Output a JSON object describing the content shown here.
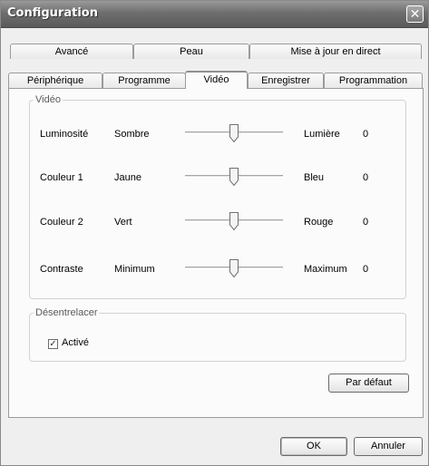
{
  "window": {
    "title": "Configuration",
    "close_symbol": "✕"
  },
  "tabs": {
    "row1": [
      {
        "label": "Avancé"
      },
      {
        "label": "Peau"
      },
      {
        "label": "Mise à jour en direct"
      }
    ],
    "row2": [
      {
        "label": "Périphérique"
      },
      {
        "label": "Programme"
      },
      {
        "label": "Vidéo",
        "active": true
      },
      {
        "label": "Enregistrer"
      },
      {
        "label": "Programmation"
      }
    ]
  },
  "video_group": {
    "title": "Vidéo",
    "rows": [
      {
        "label": "Luminosité",
        "min": "Sombre",
        "max": "Lumière",
        "value": "0",
        "position": 0.5
      },
      {
        "label": "Couleur 1",
        "min": "Jaune",
        "max": "Bleu",
        "value": "0",
        "position": 0.5
      },
      {
        "label": "Couleur 2",
        "min": "Vert",
        "max": "Rouge",
        "value": "0",
        "position": 0.5
      },
      {
        "label": "Contraste",
        "min": "Minimum",
        "max": "Maximum",
        "value": "0",
        "position": 0.5
      }
    ]
  },
  "deinterlace_group": {
    "title": "Désentrelacer",
    "checkbox_label": "Activé",
    "checked": true
  },
  "buttons": {
    "default_label": "Par défaut",
    "ok_label": "OK",
    "cancel_label": "Annuler"
  }
}
